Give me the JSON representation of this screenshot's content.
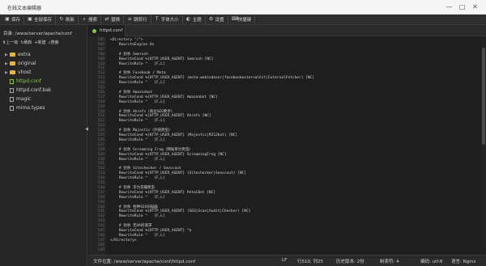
{
  "window": {
    "title": "在线文本编辑器",
    "min_label": "—",
    "max_label": "□",
    "close_label": "✕"
  },
  "toolbar": {
    "items": [
      {
        "label": "保存",
        "icon": "save-icon"
      },
      {
        "label": "全部保存",
        "icon": "save-all-icon"
      },
      {
        "label": "刷新",
        "icon": "refresh-icon"
      },
      {
        "label": "搜索",
        "icon": "search-icon"
      },
      {
        "label": "替换",
        "icon": "replace-icon"
      },
      {
        "label": "跳转行",
        "icon": "goto-line-icon"
      },
      {
        "label": "字体大小",
        "icon": "font-size-icon"
      },
      {
        "label": "主题",
        "icon": "theme-icon"
      },
      {
        "label": "设置",
        "icon": "gear-icon"
      },
      {
        "label": "快捷键",
        "icon": "shortcut-icon"
      }
    ]
  },
  "sidebar": {
    "directory_label": "目录: /www/server/apache/conf",
    "actions": [
      "上一级",
      "刷新",
      "新建",
      "搜索"
    ],
    "items": [
      {
        "label": "extra",
        "type": "folder"
      },
      {
        "label": "original",
        "type": "folder"
      },
      {
        "label": "vhost",
        "type": "folder"
      },
      {
        "label": "httpd.conf",
        "type": "file",
        "active": true
      },
      {
        "label": "httpd.conf.bak",
        "type": "file"
      },
      {
        "label": "magic",
        "type": "file"
      },
      {
        "label": "mime.types",
        "type": "file"
      }
    ]
  },
  "tabs": [
    {
      "label": "httpd.conf"
    }
  ],
  "editor": {
    "lines": [
      {
        "n": "505",
        "t": "<Directory \"/\">"
      },
      {
        "n": "506",
        "t": "    RewriteEngine On"
      },
      {
        "n": "507",
        "t": ""
      },
      {
        "n": "508",
        "t": "    # 封杀 Semrush"
      },
      {
        "n": "509",
        "t": "    RewriteCond %{HTTP_USER_AGENT} Semrush [NC]"
      },
      {
        "n": "510",
        "t": "    RewriteRule ^   [F,L]"
      },
      {
        "n": "511",
        "t": ""
      },
      {
        "n": "512",
        "t": "    # 封杀 Facebook / Meta"
      },
      {
        "n": "513",
        "t": "    RewriteCond %{HTTP_USER_AGENT} (meta-webindexer|facebookexternalhit|ExternalFetcher) [NC]"
      },
      {
        "n": "514",
        "t": "    RewriteRule ^   [F,L]"
      },
      {
        "n": "515",
        "t": ""
      },
      {
        "n": "516",
        "t": "    # 封杀 Amazonbot"
      },
      {
        "n": "517",
        "t": "    RewriteCond %{HTTP_USER_AGENT} Amazonbot [NC]"
      },
      {
        "n": "518",
        "t": "    RewriteRule ^   [F,L]"
      },
      {
        "n": "519",
        "t": ""
      },
      {
        "n": "520",
        "t": "    # 封杀 Ahrefs（商业SEO爬手）"
      },
      {
        "n": "521",
        "t": "    RewriteCond %{HTTP_USER_AGENT} Ahrefs [NC]"
      },
      {
        "n": "522",
        "t": "    RewriteRule ^   [F,L]"
      },
      {
        "n": "523",
        "t": ""
      },
      {
        "n": "524",
        "t": "    # 封杀 Majestic（外链爬虫）"
      },
      {
        "n": "525",
        "t": "    RewriteCond %{HTTP_USER_AGENT} (Majestic|MJ12bot) [NC]"
      },
      {
        "n": "526",
        "t": "    RewriteRule ^   [F,L]"
      },
      {
        "n": "527",
        "t": ""
      },
      {
        "n": "528",
        "t": "    # 封杀 Screaming Frog（网站审计爬虫）"
      },
      {
        "n": "529",
        "t": "    RewriteCond %{HTTP_USER_AGENT} ScreamingFrog [NC]"
      },
      {
        "n": "530",
        "t": "    RewriteRule ^   [F,L]"
      },
      {
        "n": "531",
        "t": ""
      },
      {
        "n": "532",
        "t": "    # 封杀 Sitechecker / Seoscout"
      },
      {
        "n": "533",
        "t": "    RewriteCond %{HTTP_USER_AGENT} (Sitechecker|Seoscout) [NC]"
      },
      {
        "n": "534",
        "t": "    RewriteRule ^   [F,L]"
      },
      {
        "n": "535",
        "t": ""
      },
      {
        "n": "536",
        "t": "    # 封杀 华为花瓣爬虫"
      },
      {
        "n": "537",
        "t": "    RewriteCond %{HTTP_USER_AGENT} PetalBot [NC]"
      },
      {
        "n": "538",
        "t": "    RewriteRule ^   [F,L]"
      },
      {
        "n": "539",
        "t": ""
      },
      {
        "n": "540",
        "t": "    # 封杀 各种SEO扫描器"
      },
      {
        "n": "541",
        "t": "    RewriteCond %{HTTP_USER_AGENT} (SEO|Scan|Audit|Checker) [NC]"
      },
      {
        "n": "542",
        "t": "    RewriteRule ^   [F,L]"
      },
      {
        "n": "543",
        "t": ""
      },
      {
        "n": "544",
        "t": "    # 封杀 无UA的请求"
      },
      {
        "n": "545",
        "t": "    RewriteCond %{HTTP_USER_AGENT} ^$"
      },
      {
        "n": "546",
        "t": "    RewriteRule ^   [F,L]"
      },
      {
        "n": "547",
        "t": "</Directory>"
      },
      {
        "n": "548",
        "t": ""
      },
      {
        "n": "549",
        "t": ""
      }
    ]
  },
  "status": {
    "file_path": "文件位置: /www/server/apache/conf/httpd.conf",
    "eol": "LF",
    "cursor": "行510, 列25",
    "history": "历史版本: 2份",
    "indent": "制表符: 4",
    "encoding": "编码: utf-8",
    "language": "语言: Nginx"
  }
}
